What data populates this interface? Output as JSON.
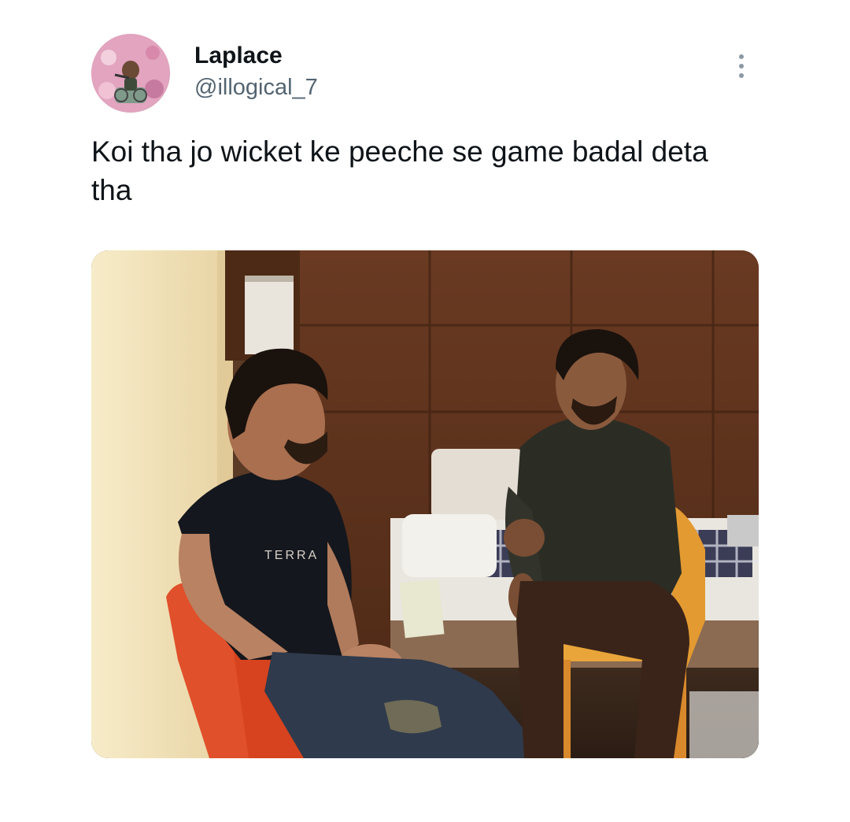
{
  "author": {
    "display_name": "Laplace",
    "handle": "@illogical_7",
    "avatar_icon": "avatar-image"
  },
  "tweet": {
    "text": "Koi tha jo wicket ke peeche se game badal deta tha",
    "media_icon": "photo-image",
    "tshirt_print": "TERRA"
  },
  "menu": {
    "more_icon": "more-vertical-icon"
  },
  "colors": {
    "text_primary": "#0f1419",
    "text_secondary": "#536471",
    "icon_gray": "#8b98a5"
  }
}
